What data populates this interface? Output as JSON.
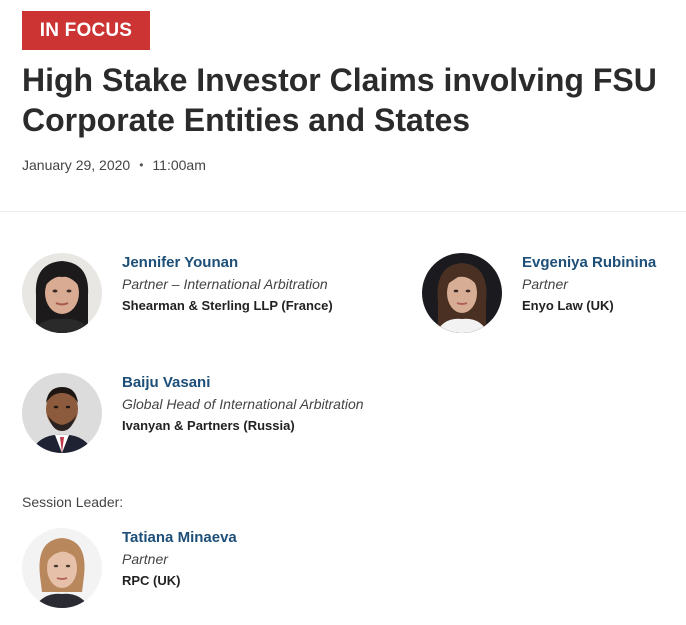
{
  "badge": "IN FOCUS",
  "title": "High Stake Investor Claims involving FSU Corporate Entities and States",
  "date": "January 29, 2020",
  "separator": "•",
  "time": "11:00am",
  "speakers": [
    {
      "name": "Jennifer Younan",
      "role": "Partner – International Arbitration",
      "org": "Shearman & Sterling LLP (France)"
    },
    {
      "name": "Evgeniya Rubinina",
      "role": "Partner",
      "org": "Enyo Law (UK)"
    },
    {
      "name": "Baiju Vasani",
      "role": "Global Head of International Arbitration",
      "org": "Ivanyan & Partners (Russia)"
    }
  ],
  "session_leader_label": "Session Leader:",
  "session_leader": {
    "name": "Tatiana Minaeva",
    "role": "Partner",
    "org": "RPC (UK)"
  },
  "colors": {
    "badge": "#cc3333",
    "name_link": "#1d4f78"
  }
}
